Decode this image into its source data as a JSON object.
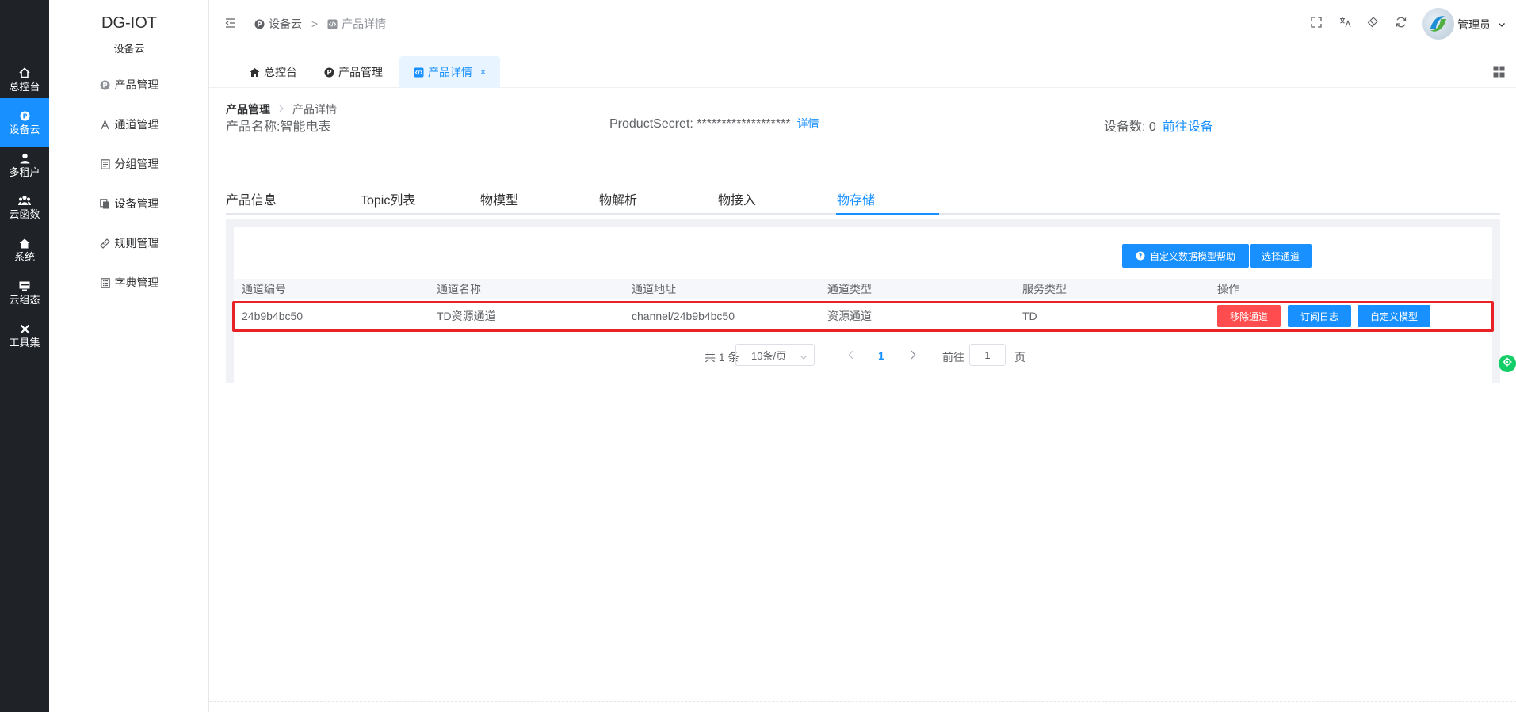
{
  "rail": {
    "items": [
      {
        "label": "总控台",
        "icon": "home-icon"
      },
      {
        "label": "设备云",
        "icon": "device-cloud-icon"
      },
      {
        "label": "多租户",
        "icon": "user-icon"
      },
      {
        "label": "云函数",
        "icon": "group-icon"
      },
      {
        "label": "系统",
        "icon": "system-home-icon"
      },
      {
        "label": "云组态",
        "icon": "monitor-icon"
      },
      {
        "label": "工具集",
        "icon": "tools-icon"
      }
    ],
    "active_index": 1
  },
  "brand": {
    "title": "DG-IOT",
    "subtitle": "设备云"
  },
  "submenu": [
    {
      "label": "产品管理",
      "icon": "product-icon"
    },
    {
      "label": "通道管理",
      "icon": "channel-icon"
    },
    {
      "label": "分组管理",
      "icon": "group-doc-icon"
    },
    {
      "label": "设备管理",
      "icon": "device-copy-icon"
    },
    {
      "label": "规则管理",
      "icon": "ruler-icon"
    },
    {
      "label": "字典管理",
      "icon": "dictionary-icon"
    }
  ],
  "topbar": {
    "breadcrumb": [
      {
        "label": "设备云",
        "icon": "p-circle-icon"
      },
      {
        "label": "产品详情",
        "icon": "code-icon"
      }
    ],
    "separator": ">",
    "user_name": "管理员"
  },
  "tabs": [
    {
      "label": "总控台",
      "icon": "home-icon"
    },
    {
      "label": "产品管理",
      "icon": "p-circle-icon"
    },
    {
      "label": "产品详情",
      "icon": "code-icon",
      "closable": "×"
    }
  ],
  "page": {
    "breadcrumb": {
      "parent": "产品管理",
      "current": "产品详情"
    },
    "product_name_label": "产品名称:智能电表",
    "product_secret_label": "ProductSecret: *******************",
    "detail_link": "详情",
    "device_count_label": "设备数: 0",
    "goto_devices_link": "前往设备"
  },
  "detail_tabs": [
    "产品信息",
    "Topic列表",
    "物模型",
    "物解析",
    "物接入",
    "物存储"
  ],
  "detail_tabs_active": 5,
  "storage": {
    "help_button": "自定义数据模型帮助",
    "select_channel_button": "选择通道",
    "columns": [
      "通道编号",
      "通道名称",
      "通道地址",
      "通道类型",
      "服务类型",
      "操作"
    ],
    "rows": [
      {
        "id": "24b9b4bc50",
        "name": "TD资源通道",
        "address": "channel/24b9b4bc50",
        "type": "资源通道",
        "service": "TD",
        "actions": {
          "remove": "移除通道",
          "subscribe": "订阅日志",
          "custom_model": "自定义模型"
        }
      }
    ],
    "pagination": {
      "total_label": "共 1 条",
      "page_size": "10条/页",
      "current_page": "1",
      "goto_label": "前往",
      "goto_value": "1",
      "page_unit": "页"
    }
  },
  "colors": {
    "accent": "#1890ff",
    "danger": "#ff4d4f",
    "rail_bg": "#1f2227",
    "highlight_border": "#e82226",
    "float_button": "#13ce66"
  }
}
